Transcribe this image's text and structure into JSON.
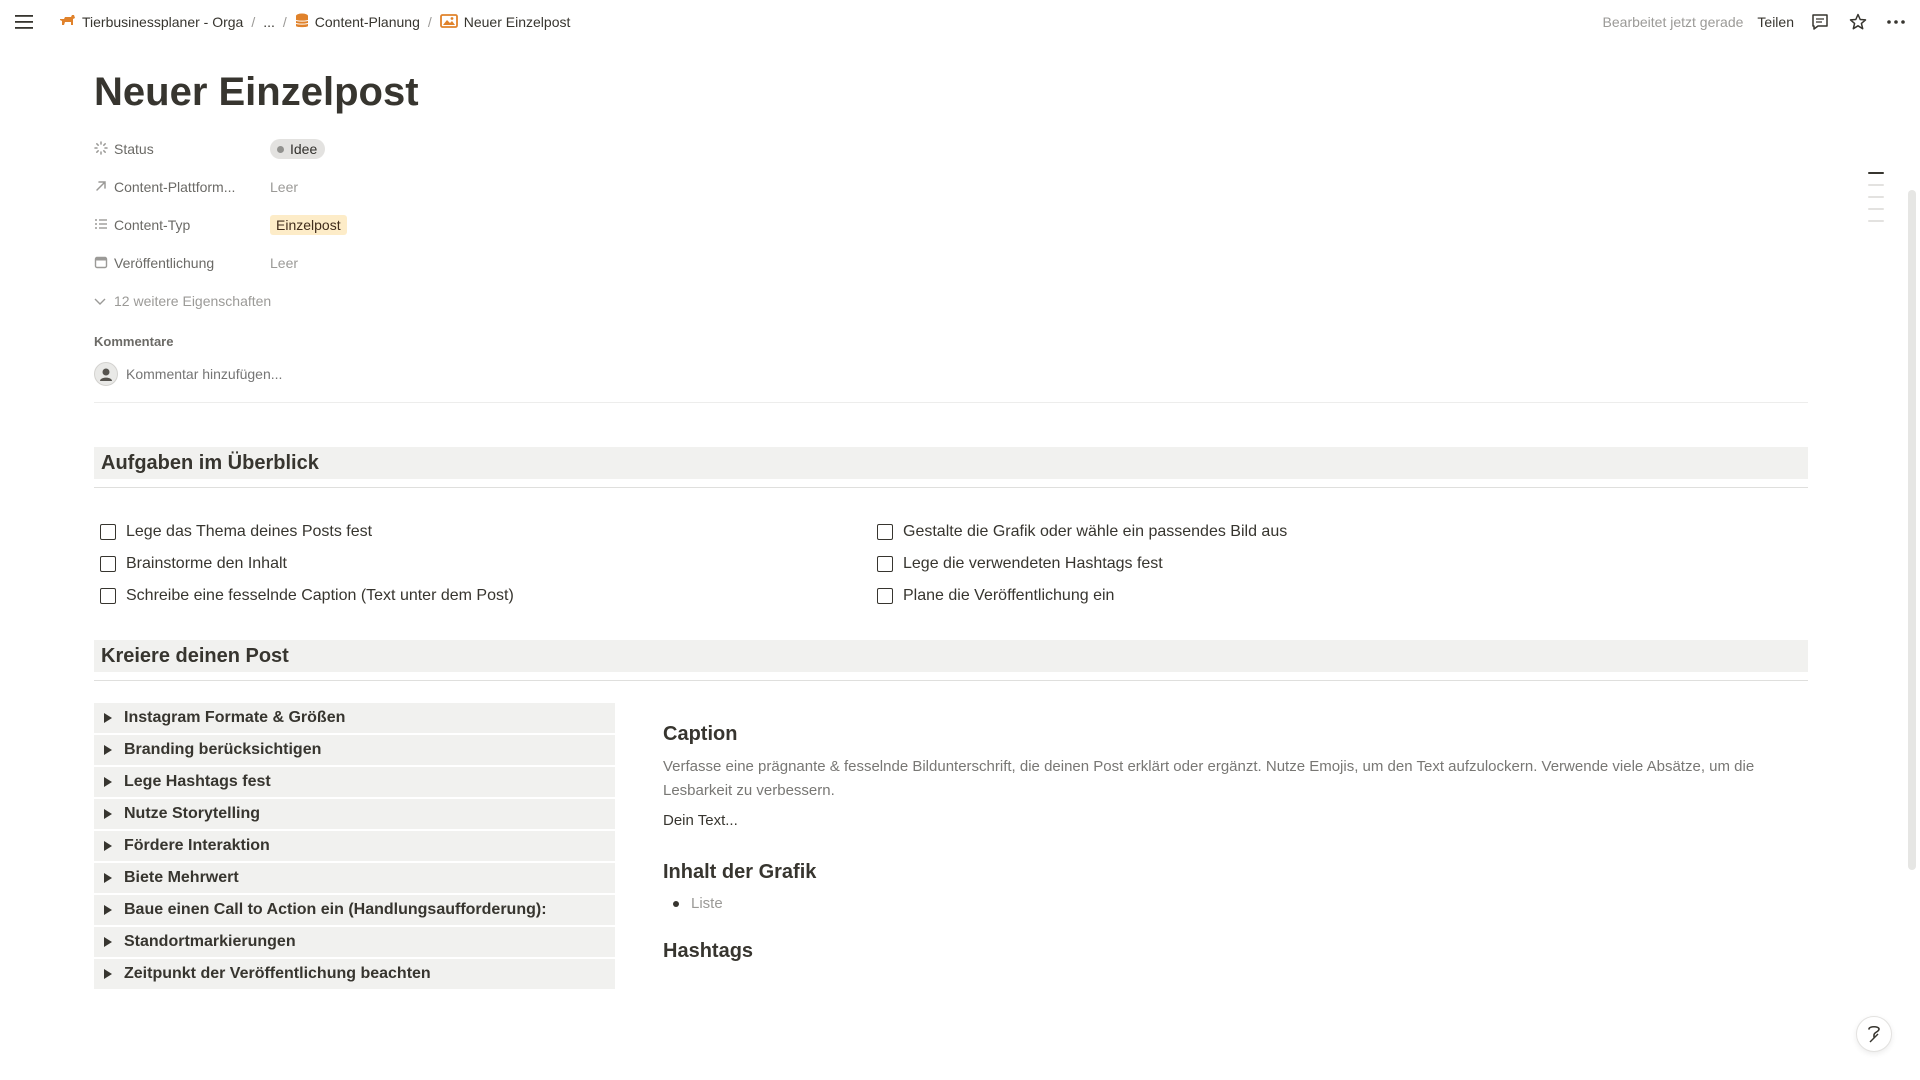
{
  "topbar": {
    "breadcrumb": [
      {
        "label": "Tierbusinessplaner - Orga",
        "icon": "dog-icon"
      },
      {
        "label": "..."
      },
      {
        "label": "Content-Planung",
        "icon": "database-icon"
      },
      {
        "label": "Neuer Einzelpost",
        "icon": "image-icon"
      }
    ],
    "separator": "/",
    "edited": "Bearbeitet jetzt gerade",
    "share": "Teilen"
  },
  "page": {
    "title": "Neuer Einzelpost",
    "properties": [
      {
        "label": "Status",
        "value": "Idee"
      },
      {
        "label": "Content-Plattform...",
        "value": "Leer"
      },
      {
        "label": "Content-Typ",
        "value": "Einzelpost"
      },
      {
        "label": "Veröffentlichung",
        "value": "Leer"
      }
    ],
    "more_properties": "12 weitere Eigenschaften",
    "comments_heading": "Kommentare",
    "comment_placeholder": "Kommentar hinzufügen..."
  },
  "tasks": {
    "heading": "Aufgaben im Überblick",
    "left": [
      "Lege das Thema deines Posts fest",
      "Brainstorme den Inhalt",
      "Schreibe eine fesselnde Caption (Text unter dem Post)"
    ],
    "right": [
      "Gestalte die Grafik oder wähle ein passendes Bild aus",
      "Lege die verwendeten Hashtags fest",
      "Plane die Veröffentlichung ein"
    ]
  },
  "create": {
    "heading": "Kreiere deinen Post",
    "toggles": [
      "Instagram Formate & Größen",
      "Branding berücksichtigen",
      "Lege Hashtags fest",
      "Nutze Storytelling",
      "Fördere Interaktion",
      "Biete Mehrwert",
      "Baue einen Call to Action ein (Handlungsaufforderung):",
      "Standortmarkierungen",
      "Zeitpunkt der Veröffentlichung beachten"
    ],
    "caption_heading": "Caption",
    "caption_desc": "Verfasse eine prägnante & fesselnde Bildunterschrift, die deinen Post erklärt oder ergänzt. Nutze Emojis, um den Text aufzulockern. Verwende viele Absätze, um die Lesbarkeit zu verbessern.",
    "caption_text": "Dein Text...",
    "graphic_heading": "Inhalt der Grafik",
    "graphic_list_item": "Liste",
    "hashtags_heading": "Hashtags"
  },
  "colors": {
    "text": "#37352f",
    "muted": "#9b9a97",
    "block_bg": "#f1f1ef",
    "status_tag_bg": "#e3e2e0",
    "type_tag_bg": "#fdecc8",
    "brand_orange": "#e0822b"
  }
}
